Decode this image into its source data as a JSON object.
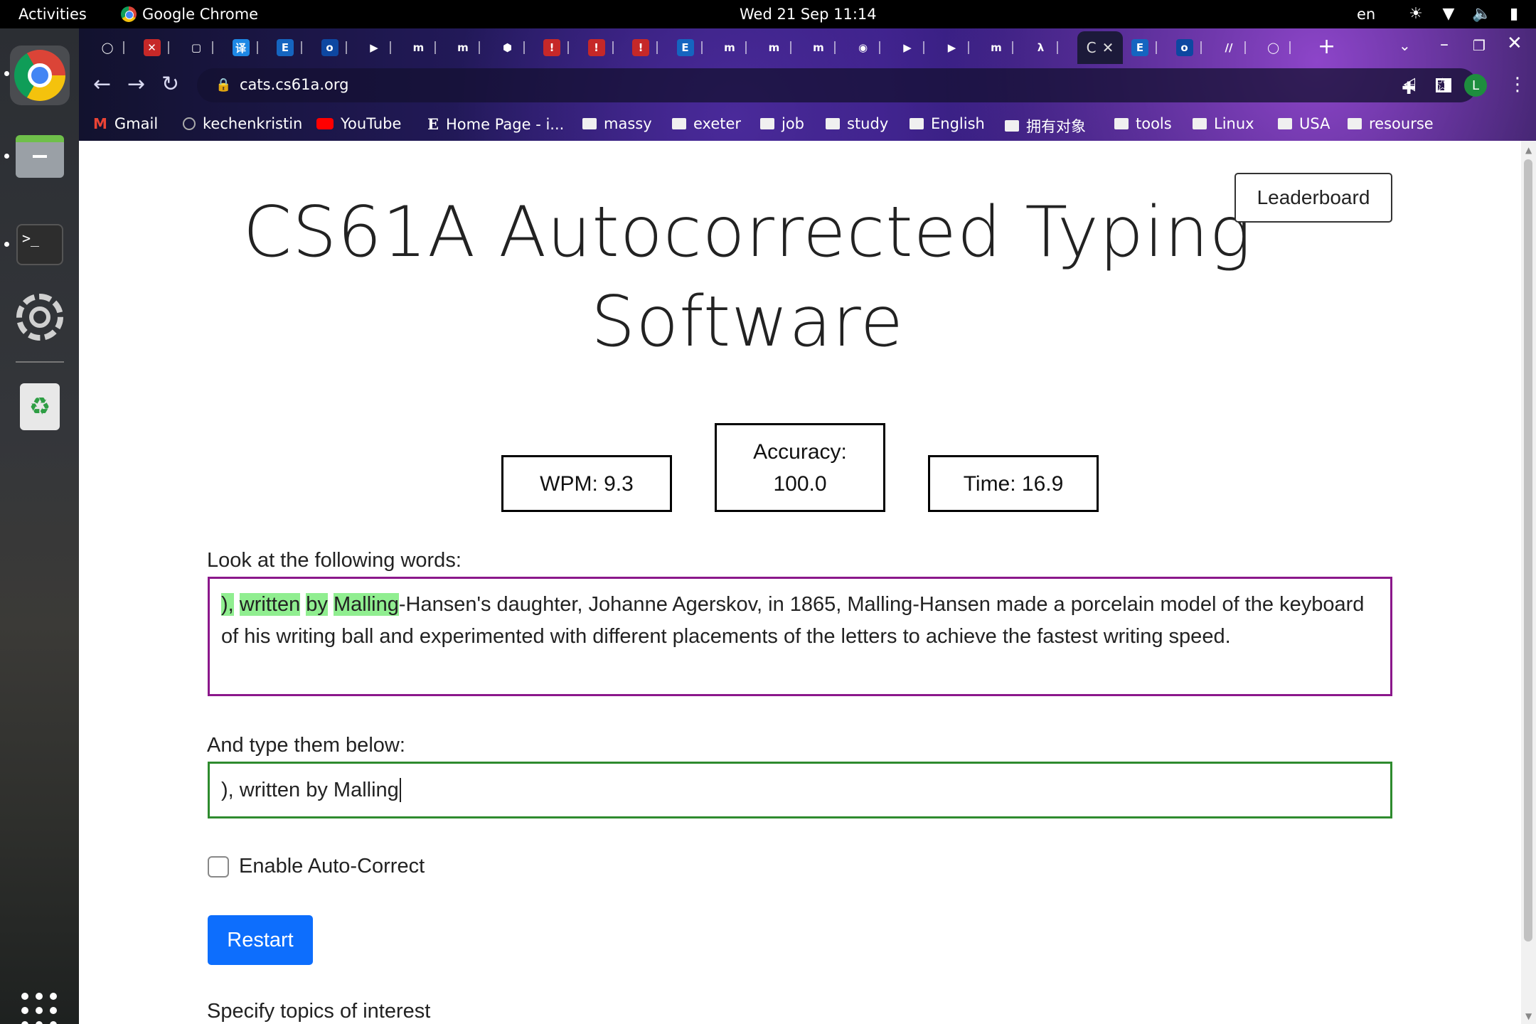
{
  "topbar": {
    "activities": "Activities",
    "app_name": "Google Chrome",
    "clock": "Wed 21 Sep  11:14",
    "lang": "en"
  },
  "browser": {
    "url": "cats.cs61a.org",
    "active_tab_label": "C",
    "profile_initial": "L",
    "bookmarks": [
      "Gmail",
      "kechenkristin",
      "YouTube",
      "Home Page - i...",
      "massy",
      "exeter",
      "job",
      "study",
      "English",
      "拥有对象",
      "tools",
      "Linux",
      "USA",
      "resourse"
    ]
  },
  "page": {
    "title": "CS61A Autocorrected Typing Software",
    "leaderboard_label": "Leaderboard",
    "wpm": "WPM: 9.3",
    "accuracy_label": "Accuracy:",
    "accuracy_value": "100.0",
    "time": "Time: 16.9",
    "look_label": "Look at the following words:",
    "prompt_typed_words": [
      "),",
      "written",
      "by",
      "Malling"
    ],
    "prompt_rest": "-Hansen's daughter, Johanne Agerskov, in 1865, Malling-Hansen made a porcelain model of the keyboard of his writing ball and experimented with different placements of the letters to achieve the fastest writing speed.",
    "type_label": "And type them below:",
    "typed_value": "), written by Malling",
    "autocorrect_label": "Enable Auto-Correct",
    "autocorrect_checked": false,
    "restart_label": "Restart",
    "topics_label": "Specify topics of interest"
  },
  "colors": {
    "prompt_border": "#8b178b",
    "input_border": "#2e8b2e",
    "highlight": "#90ee90",
    "primary_button": "#0d6efd"
  }
}
